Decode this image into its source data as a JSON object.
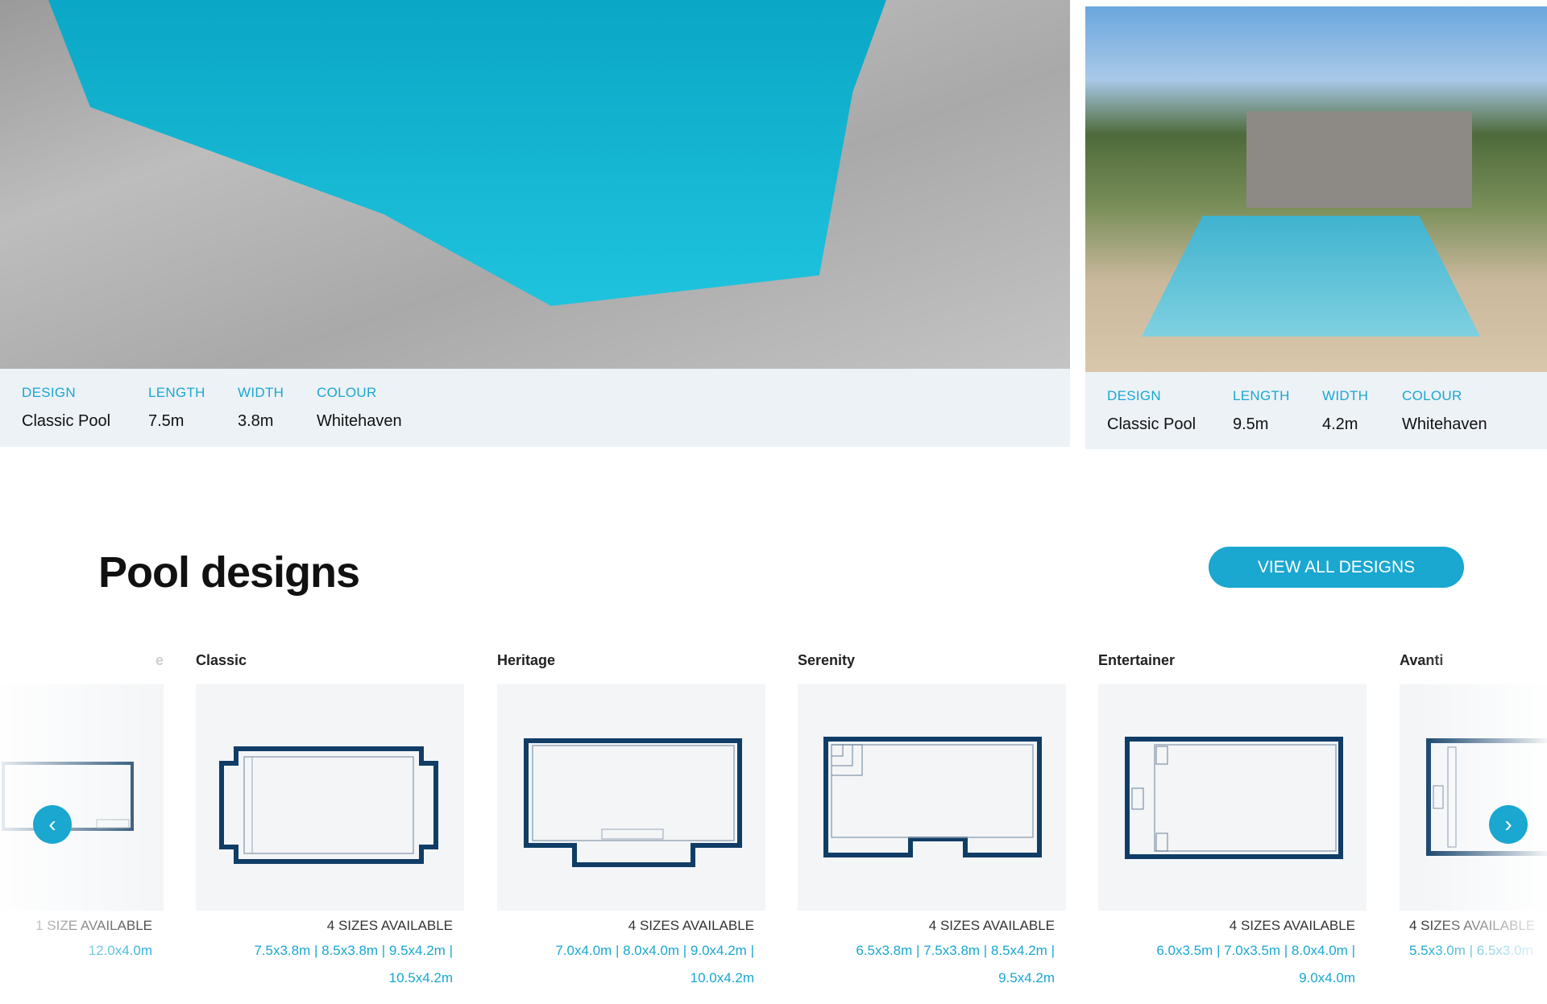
{
  "gallery": [
    {
      "labels": [
        "DESIGN",
        "LENGTH",
        "WIDTH",
        "COLOUR"
      ],
      "values": [
        "Classic Pool",
        "7.5m",
        "3.8m",
        "Whitehaven"
      ]
    },
    {
      "labels": [
        "DESIGN",
        "LENGTH",
        "WIDTH",
        "COLOUR"
      ],
      "values": [
        "Classic Pool",
        "9.5m",
        "4.2m",
        "Whitehaven"
      ]
    }
  ],
  "section": {
    "title": "Pool designs",
    "button": "VIEW ALL DESIGNS"
  },
  "designs": [
    {
      "name": "e",
      "available": "1 SIZE AVAILABLE",
      "sizes": [
        "12.0x4.0m"
      ]
    },
    {
      "name": "Classic",
      "available": "4 SIZES AVAILABLE",
      "sizes": [
        "7.5x3.8m | 8.5x3.8m | 9.5x4.2m |",
        "10.5x4.2m"
      ]
    },
    {
      "name": "Heritage",
      "available": "4 SIZES AVAILABLE",
      "sizes": [
        "7.0x4.0m | 8.0x4.0m | 9.0x4.2m |",
        "10.0x4.2m"
      ]
    },
    {
      "name": "Serenity",
      "available": "4 SIZES AVAILABLE",
      "sizes": [
        "6.5x3.8m | 7.5x3.8m | 8.5x4.2m |",
        "9.5x4.2m"
      ]
    },
    {
      "name": "Entertainer",
      "available": "4 SIZES AVAILABLE",
      "sizes": [
        "6.0x3.5m | 7.0x3.5m | 8.0x4.0m |",
        "9.0x4.0m"
      ]
    },
    {
      "name": "Avanti",
      "available": "4 SIZES AVAILABLE",
      "sizes": [
        "5.5x3.0m | 6.5x3.0m"
      ]
    }
  ],
  "icons": {
    "prev": "chevron-left-icon",
    "next": "chevron-right-icon"
  },
  "colors": {
    "accent": "#1aa7d0",
    "outline": "#0f3d66",
    "panel": "#edf2f7"
  }
}
